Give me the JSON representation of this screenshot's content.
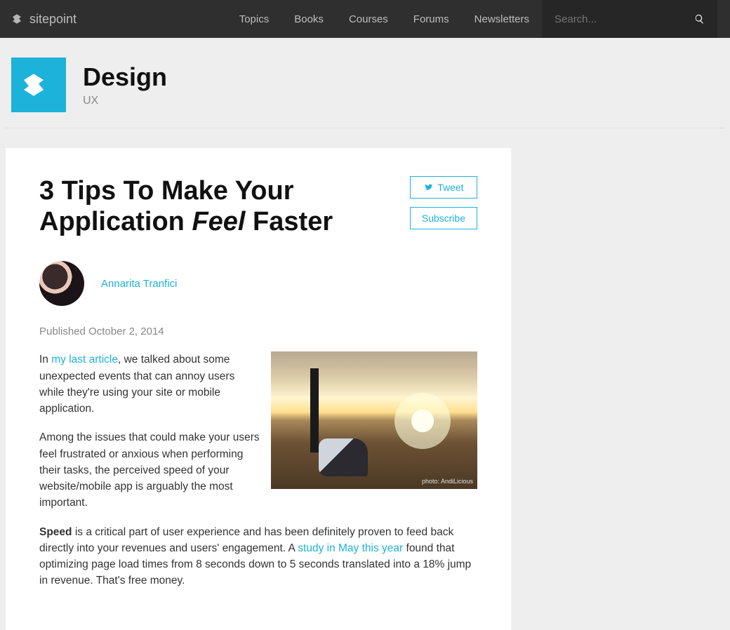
{
  "brand": "sitepoint",
  "nav": {
    "topics": "Topics",
    "books": "Books",
    "courses": "Courses",
    "forums": "Forums",
    "newsletters": "Newsletters"
  },
  "search": {
    "placeholder": "Search..."
  },
  "header": {
    "category": "Design",
    "sub": "UX"
  },
  "actions": {
    "tweet": "Tweet",
    "subscribe": "Subscribe"
  },
  "article": {
    "title_pre": "3 Tips To Make Your Application ",
    "title_em": "Feel",
    "title_post": " Faster",
    "author": "Annarita Tranfici",
    "published_label": "Published ",
    "published_date": "October 2, 2014",
    "p1_a": "In ",
    "p1_link": "my last article",
    "p1_b": ", we talked about some unexpected events that can annoy users while they're using your site or mobile application.",
    "p2": "Among the issues that could make your users feel frustrated or anxious when performing their tasks, the perceived speed of your website/mobile app is arguably the most important.",
    "p3_strong": "Speed",
    "p3_a": " is a critical part of user experience and has been definitely proven to feed back directly into your revenues and users' engagement. A ",
    "p3_link": "study in May this year",
    "p3_b": " found that optimizing page load times from 8 seconds down to 5 seconds translated into a 18% jump in revenue. That's free money.",
    "hero_caption": "photo: AndiLicious"
  }
}
